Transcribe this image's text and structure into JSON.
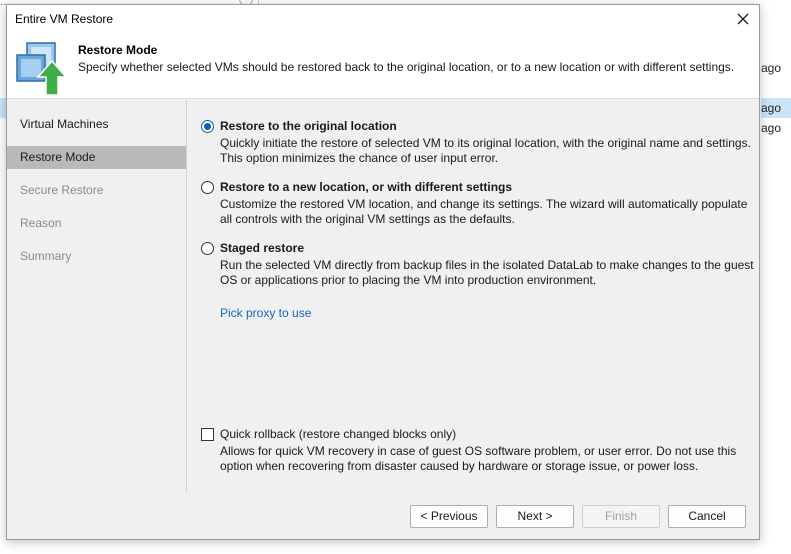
{
  "background": {
    "search_placeholder": "...",
    "ago_labels": [
      "ago",
      "ago",
      "ago"
    ]
  },
  "dialog": {
    "title": "Entire VM Restore",
    "header": {
      "title": "Restore Mode",
      "description": "Specify whether selected VMs should be restored back to the original location, or to a new location or with different settings."
    },
    "nav": [
      {
        "label": "Virtual Machines",
        "state": "done"
      },
      {
        "label": "Restore Mode",
        "state": "active"
      },
      {
        "label": "Secure Restore",
        "state": "pending"
      },
      {
        "label": "Reason",
        "state": "pending"
      },
      {
        "label": "Summary",
        "state": "pending"
      }
    ],
    "options": [
      {
        "label": "Restore to the original location",
        "description": "Quickly initiate the restore of selected VM to its original location, with the original name and settings. This option minimizes the chance of user input error.",
        "selected": true
      },
      {
        "label": "Restore to a new location, or with different settings",
        "description": "Customize the restored VM location, and change its settings. The wizard will automatically populate all controls with the original VM settings as the defaults.",
        "selected": false
      },
      {
        "label": "Staged restore",
        "description": "Run the selected VM directly from backup files in the isolated DataLab to make changes to the guest OS or applications prior to placing the VM into production environment.",
        "selected": false
      }
    ],
    "proxy_link": "Pick proxy to use",
    "quick_rollback": {
      "label": "Quick rollback (restore changed blocks only)",
      "description": "Allows for quick VM recovery in case of guest OS software problem, or user error. Do not use this option when recovering from disaster caused by hardware or storage issue, or power loss.",
      "checked": false
    },
    "buttons": {
      "previous": "< Previous",
      "next": "Next >",
      "finish": "Finish",
      "cancel": "Cancel"
    }
  },
  "colors": {
    "accent": "#0f5fb5",
    "link": "#1665c0",
    "nav_active_bg": "#b9b9b9",
    "icon_arrow": "#3fae49"
  },
  "icons": {
    "close": "close-icon",
    "header": "vm-restore-icon"
  }
}
